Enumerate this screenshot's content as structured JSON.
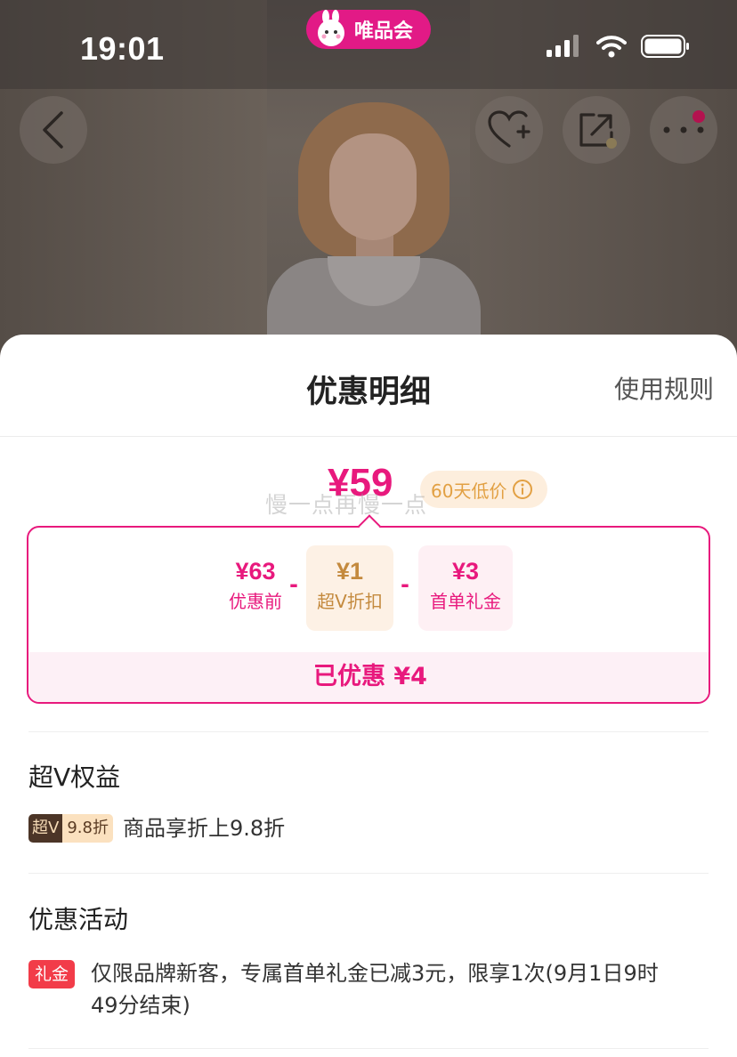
{
  "status_bar": {
    "time": "19:01",
    "brand": "唯品会"
  },
  "nav": {
    "back": "back",
    "favorite": "favorite-add",
    "share": "share",
    "more": "more"
  },
  "sheet": {
    "title": "优惠明细",
    "rules_link": "使用规则",
    "final_price": "¥59",
    "low_price_badge": "60天低价",
    "watermark": "慢一点再慢一点",
    "breakdown": {
      "before": {
        "amount": "¥63",
        "label": "优惠前"
      },
      "superv": {
        "amount": "¥1",
        "label": "超V折扣"
      },
      "gift": {
        "amount": "¥3",
        "label": "首单礼金"
      },
      "minus": "-",
      "saved": "已优惠 ¥4"
    },
    "superv_section": {
      "title": "超V权益",
      "tag_left": "超V",
      "tag_right": "9.8折",
      "text": "商品享折上9.8折"
    },
    "promo_section": {
      "title": "优惠活动",
      "tag": "礼金",
      "text_line1": "仅限品牌新客，专属首单礼金已减3元，限享1次(9月1日9时",
      "text_line2": "49分结束)"
    }
  },
  "colors": {
    "accent": "#e8197d",
    "brand": "#e21a86",
    "gold": "#c48a3e",
    "gift_red": "#f23c49"
  }
}
